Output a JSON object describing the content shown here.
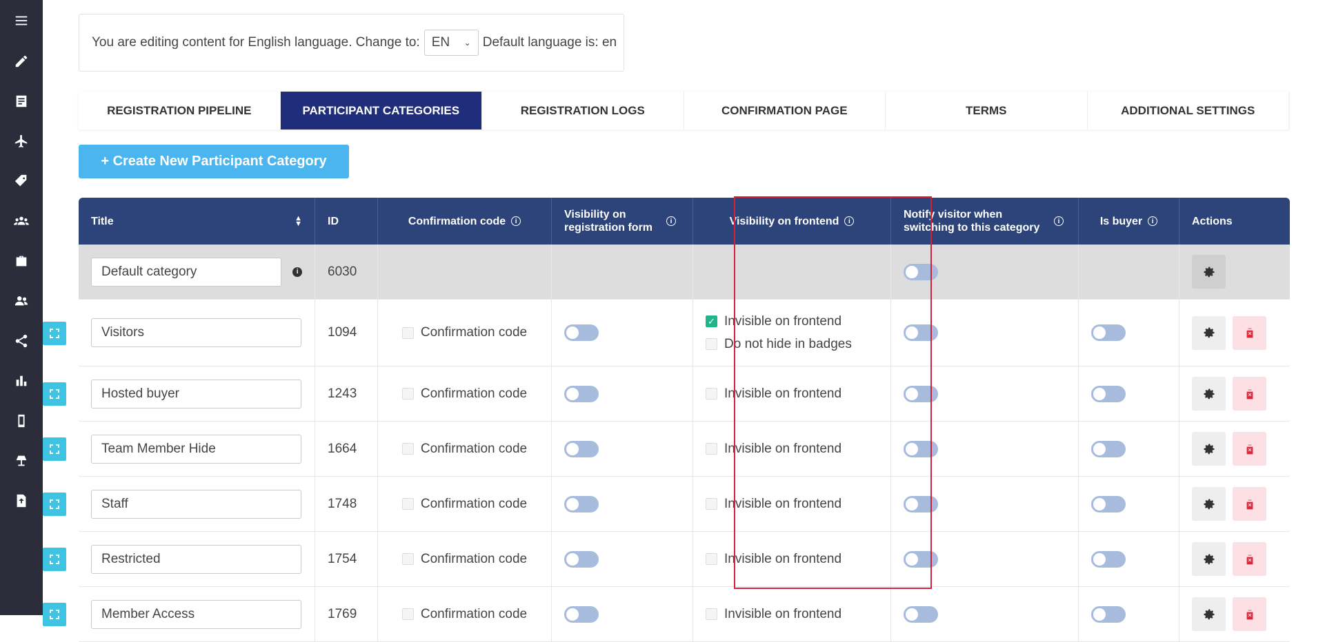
{
  "sidebar": {
    "items": [
      {
        "icon": "menu-icon"
      },
      {
        "icon": "pencil-icon"
      },
      {
        "icon": "document-icon"
      },
      {
        "icon": "plane-icon"
      },
      {
        "icon": "tag-icon"
      },
      {
        "icon": "group-icon"
      },
      {
        "icon": "briefcase-icon"
      },
      {
        "icon": "users-icon"
      },
      {
        "icon": "share-icon"
      },
      {
        "icon": "chart-icon"
      },
      {
        "icon": "mobile-icon"
      },
      {
        "icon": "lamp-icon"
      },
      {
        "icon": "upload-file-icon"
      }
    ]
  },
  "language": {
    "prefix": "You are editing content for English language. Change to:",
    "selected": "EN",
    "suffix": "Default language is: en"
  },
  "tabs": [
    {
      "label": "REGISTRATION PIPELINE"
    },
    {
      "label": "PARTICIPANT CATEGORIES"
    },
    {
      "label": "REGISTRATION LOGS"
    },
    {
      "label": "CONFIRMATION PAGE"
    },
    {
      "label": "TERMS"
    },
    {
      "label": "ADDITIONAL SETTINGS"
    }
  ],
  "create_button": {
    "label": "+ Create New Participant Category"
  },
  "table": {
    "headers": {
      "title": "Title",
      "id": "ID",
      "confirmation": "Confirmation code",
      "visibility_form": "Visibility on registration form",
      "visibility_frontend": "Visibility on frontend",
      "notify": "Notify visitor when switching to this category",
      "buyer": "Is buyer",
      "actions": "Actions"
    },
    "default_row": {
      "title": "Default category",
      "id": "6030"
    },
    "rows": [
      {
        "title": "Visitors",
        "id": "1094",
        "confirmation": "Confirmation code",
        "invisible": "Invisible on frontend",
        "badges": "Do not hide in badges"
      },
      {
        "title": "Hosted buyer",
        "id": "1243",
        "confirmation": "Confirmation code",
        "invisible": "Invisible on frontend"
      },
      {
        "title": "Team Member Hide",
        "id": "1664",
        "confirmation": "Confirmation code",
        "invisible": "Invisible on frontend"
      },
      {
        "title": "Staff",
        "id": "1748",
        "confirmation": "Confirmation code",
        "invisible": "Invisible on frontend"
      },
      {
        "title": "Restricted",
        "id": "1754",
        "confirmation": "Confirmation code",
        "invisible": "Invisible on frontend"
      },
      {
        "title": "Member Access",
        "id": "1769",
        "confirmation": "Confirmation code",
        "invisible": "Invisible on frontend"
      }
    ]
  },
  "colors": {
    "accent": "#1f2d7b",
    "header": "#2c4479",
    "create": "#4ab5ee",
    "highlight": "#d6203a"
  }
}
